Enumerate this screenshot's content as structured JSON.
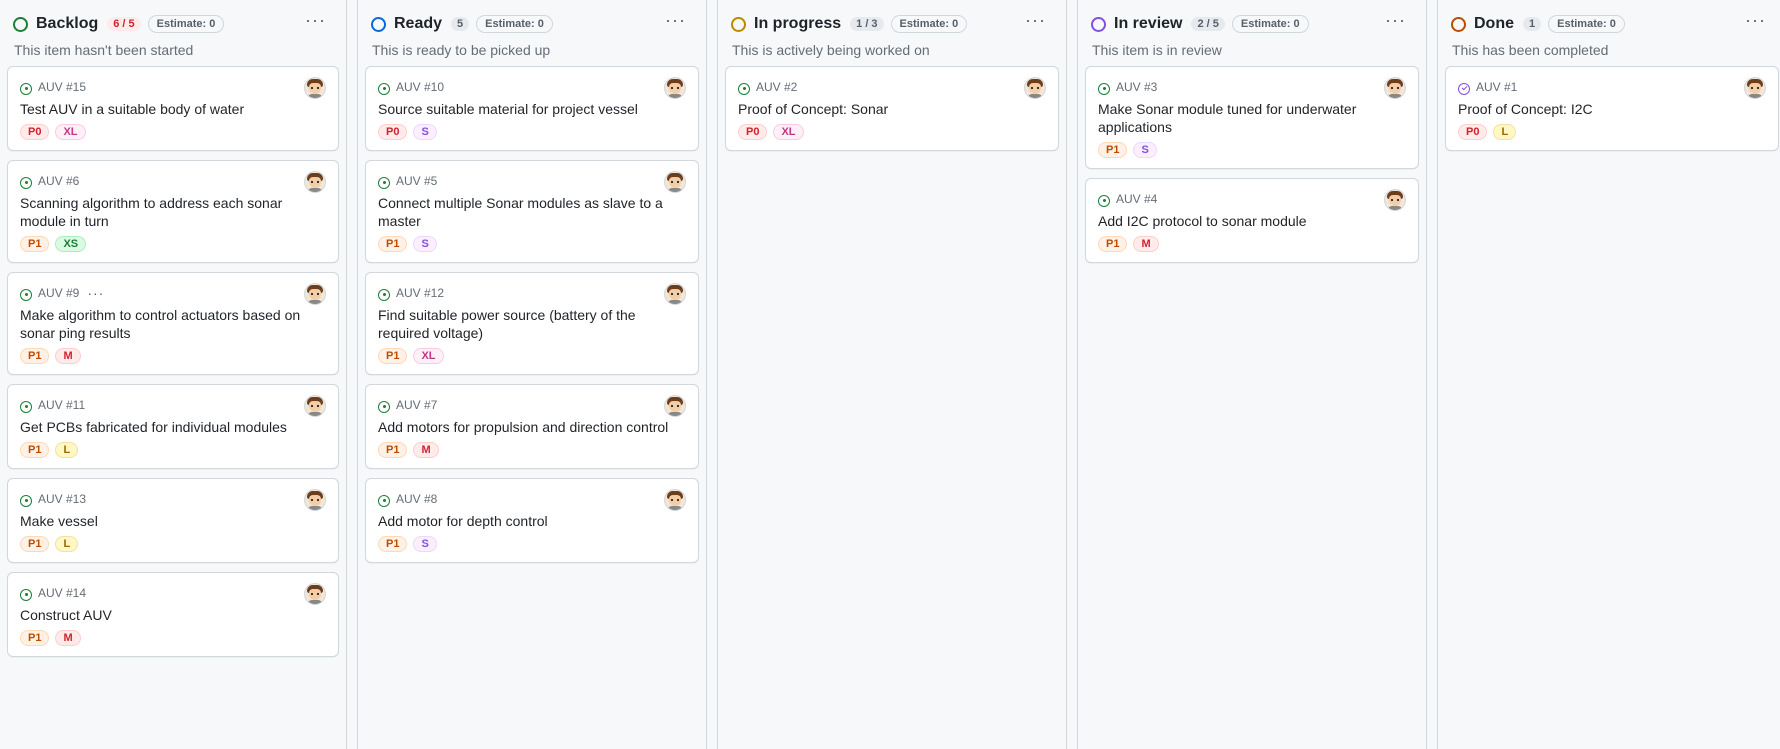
{
  "colors": {
    "backlog": "#1a7f37",
    "ready": "#0969da",
    "in_progress": "#bf8700",
    "in_review": "#8250df",
    "done": "#bc4c00"
  },
  "columns": [
    {
      "key": "backlog",
      "title": "Backlog",
      "count": "6 / 5",
      "count_over": true,
      "estimate": "Estimate: 0",
      "description": "This item hasn't been started",
      "menu_icon": "ellipsis-icon",
      "cards": [
        {
          "id": "AUV #15",
          "title": "Test AUV in a suitable body of water",
          "labels": [
            "P0",
            "XL"
          ],
          "show_menu": false,
          "done": false
        },
        {
          "id": "AUV #6",
          "title": "Scanning algorithm to address each sonar module in turn",
          "labels": [
            "P1",
            "XS"
          ],
          "show_menu": false,
          "done": false
        },
        {
          "id": "AUV #9",
          "title": "Make algorithm to control actuators based on sonar ping results",
          "labels": [
            "P1",
            "M"
          ],
          "show_menu": true,
          "done": false
        },
        {
          "id": "AUV #11",
          "title": "Get PCBs fabricated for individual modules",
          "labels": [
            "P1",
            "L"
          ],
          "show_menu": false,
          "done": false
        },
        {
          "id": "AUV #13",
          "title": "Make vessel",
          "labels": [
            "P1",
            "L"
          ],
          "show_menu": false,
          "done": false
        },
        {
          "id": "AUV #14",
          "title": "Construct AUV",
          "labels": [
            "P1",
            "M"
          ],
          "show_menu": false,
          "done": false
        }
      ]
    },
    {
      "key": "ready",
      "title": "Ready",
      "count": "5",
      "count_over": false,
      "estimate": "Estimate: 0",
      "description": "This is ready to be picked up",
      "menu_icon": "ellipsis-icon",
      "cards": [
        {
          "id": "AUV #10",
          "title": "Source suitable material for project vessel",
          "labels": [
            "P0",
            "S"
          ],
          "show_menu": false,
          "done": false
        },
        {
          "id": "AUV #5",
          "title": "Connect multiple Sonar modules as slave to a master",
          "labels": [
            "P1",
            "S"
          ],
          "show_menu": false,
          "done": false
        },
        {
          "id": "AUV #12",
          "title": "Find suitable power source (battery of the required voltage)",
          "labels": [
            "P1",
            "XL"
          ],
          "show_menu": false,
          "done": false
        },
        {
          "id": "AUV #7",
          "title": "Add motors for propulsion and direction control",
          "labels": [
            "P1",
            "M"
          ],
          "show_menu": false,
          "done": false
        },
        {
          "id": "AUV #8",
          "title": "Add motor for depth control",
          "labels": [
            "P1",
            "S"
          ],
          "show_menu": false,
          "done": false
        }
      ]
    },
    {
      "key": "in_progress",
      "title": "In progress",
      "count": "1 / 3",
      "count_over": false,
      "estimate": "Estimate: 0",
      "description": "This is actively being worked on",
      "menu_icon": "ellipsis-icon",
      "cards": [
        {
          "id": "AUV #2",
          "title": "Proof of Concept: Sonar",
          "labels": [
            "P0",
            "XL"
          ],
          "show_menu": false,
          "done": false
        }
      ]
    },
    {
      "key": "in_review",
      "title": "In review",
      "count": "2 / 5",
      "count_over": false,
      "estimate": "Estimate: 0",
      "description": "This item is in review",
      "menu_icon": "ellipsis-icon",
      "cards": [
        {
          "id": "AUV #3",
          "title": "Make Sonar module tuned for underwater applications",
          "labels": [
            "P1",
            "S"
          ],
          "show_menu": false,
          "done": false
        },
        {
          "id": "AUV #4",
          "title": "Add I2C protocol to sonar module",
          "labels": [
            "P1",
            "M"
          ],
          "show_menu": false,
          "done": false
        }
      ]
    },
    {
      "key": "done",
      "title": "Done",
      "count": "1",
      "count_over": false,
      "estimate": "Estimate: 0",
      "description": "This has been completed",
      "menu_icon": "ellipsis-icon",
      "cards": [
        {
          "id": "AUV #1",
          "title": "Proof of Concept: I2C",
          "labels": [
            "P0",
            "L"
          ],
          "show_menu": false,
          "done": true
        }
      ]
    }
  ],
  "ui": {
    "menu_glyph": "···",
    "card_menu_glyph": "···"
  }
}
